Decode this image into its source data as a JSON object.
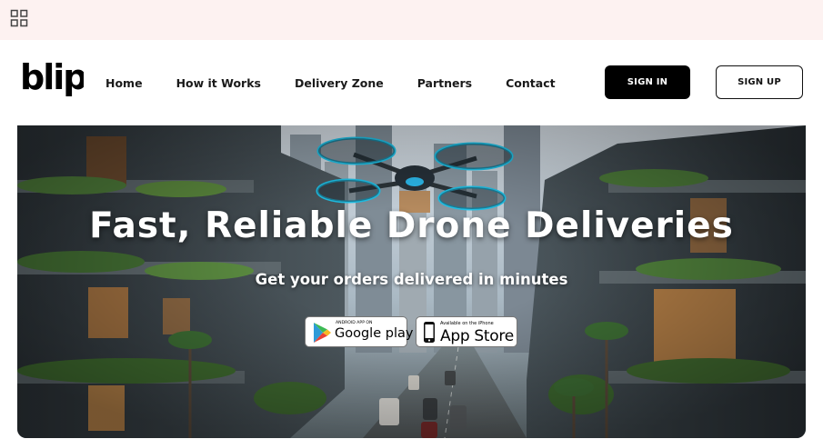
{
  "brand": {
    "logo_text": "blip"
  },
  "nav": {
    "links": [
      "Home",
      "How it Works",
      "Delivery Zone",
      "Partners",
      "Contact"
    ],
    "sign_in": "SIGN IN",
    "sign_up": "SIGN UP"
  },
  "hero": {
    "title": "Fast, Reliable Drone Deliveries",
    "subtitle": "Get your orders delivered in minutes",
    "google_play": {
      "small": "ANDROID APP ON",
      "big": "Google play",
      "icon": "google-play-icon"
    },
    "app_store": {
      "small": "Available on the iPhone",
      "big": "App Store",
      "icon": "apple-iphone-icon"
    }
  },
  "colors": {
    "topbar": "#fdf2f1",
    "button_dark": "#000000",
    "drone_accent": "#1ec0e6"
  }
}
